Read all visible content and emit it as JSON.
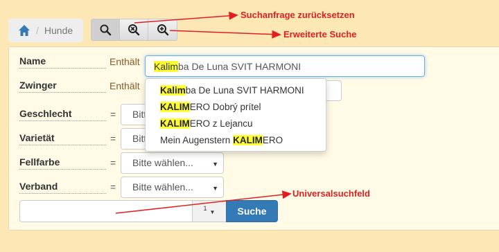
{
  "breadcrumb": {
    "home_icon": "home-icon",
    "current": "Hunde"
  },
  "toolbar": {
    "buttons": [
      "search-icon",
      "search-reset-icon",
      "search-advanced-icon"
    ]
  },
  "form": {
    "name": {
      "label": "Name",
      "qualifier": "Enthält",
      "value_highlight": "Kalim",
      "value_rest": "ba De Luna SVIT HARMONI"
    },
    "zwinger": {
      "label": "Zwinger",
      "qualifier": "Enthält"
    },
    "geschlecht": {
      "label": "Geschlecht",
      "eq": "=",
      "value": "Bitte wählen..."
    },
    "varietaet": {
      "label": "Varietät",
      "eq": "=",
      "value": "Bitte wählen..."
    },
    "fellfarbe": {
      "label": "Fellfarbe",
      "eq": "=",
      "value": "Bitte wählen..."
    },
    "verband": {
      "label": "Verband",
      "eq": "=",
      "value": "Bitte wählen..."
    }
  },
  "dropdown": {
    "items": [
      {
        "pre": "",
        "match": "Kalim",
        "post": "ba De Luna SVIT HARMONI"
      },
      {
        "pre": "",
        "match": "KALIM",
        "post": "ERO Dobrý prítel"
      },
      {
        "pre": "",
        "match": "KALIM",
        "post": "ERO z Lejancu"
      },
      {
        "pre": "Mein Augenstern ",
        "match": "KALIM",
        "post": "ERO"
      }
    ]
  },
  "universal": {
    "value": "",
    "count": "1",
    "button": "Suche"
  },
  "annotations": {
    "reset": "Suchanfrage zurücksetzen",
    "advanced": "Erweiterte Suche",
    "universal": "Universalsuchfeld"
  },
  "colors": {
    "accent": "#337ab7",
    "highlight": "#ffff33",
    "annotation": "#e02020",
    "background": "#fde7b4"
  }
}
